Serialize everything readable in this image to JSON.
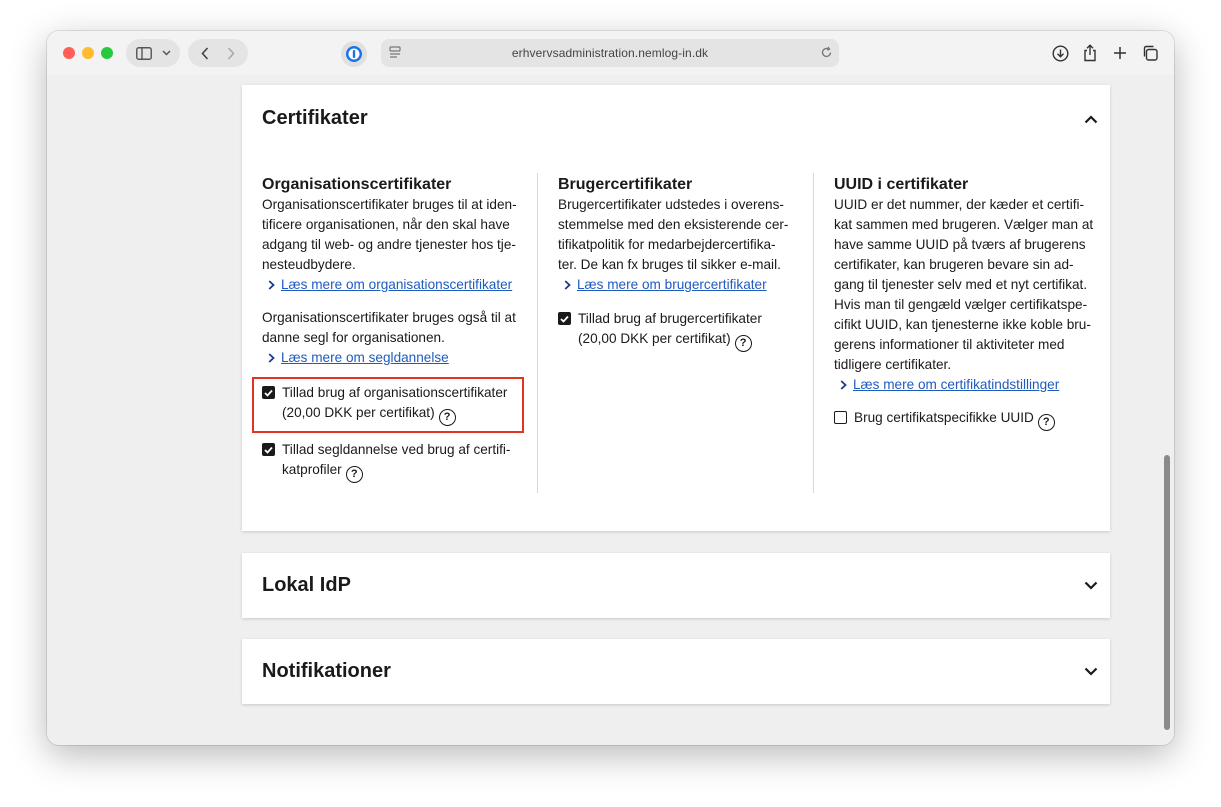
{
  "browser": {
    "url": "erhvervsadministration.nemlog-in.dk"
  },
  "sections": {
    "certifikater": {
      "title": "Certifikater",
      "columns": {
        "org": {
          "heading": "Organisationscertifikater",
          "text1": "Organisationscertifikater bruges til at iden-\ntificere organisationen, når den skal have\nadgang til web- og andre tjenester hos tje-\nnesteudbydere.",
          "link1": "Læs mere om organisationscertifikater",
          "text2": "Organisationscertifikater bruges også til at\ndanne segl for organisationen.",
          "link2": "Læs mere om segldannelse",
          "checkbox1": "Tillad brug af organisationscertifikater\n(20,00 DKK per certifikat)",
          "checkbox1_checked": true,
          "checkbox2": "Tillad segldannelse ved brug af certifi-\nkatprofiler",
          "checkbox2_checked": true
        },
        "bruger": {
          "heading": "Brugercertifikater",
          "text1": "Brugercertifikater udstedes i overens-\nstemmelse med den eksisterende cer-\ntifikatpolitik for medarbejdercertifika-\nter. De kan fx bruges til sikker e-mail.",
          "link1": "Læs mere om brugercertifikater",
          "checkbox1": "Tillad brug af brugercertifikater\n(20,00 DKK per certifikat)",
          "checkbox1_checked": true
        },
        "uuid": {
          "heading": "UUID i certifikater",
          "text1": "UUID er det nummer, der kæder et certifi-\nkat sammen med brugeren. Vælger man at\nhave samme UUID på tværs af brugerens\ncertifikater, kan brugeren bevare sin ad-\ngang til tjenester selv med et nyt certifikat.\nHvis man til gengæld vælger certifikatspe-\ncifikt UUID, kan tjenesterne ikke koble bru-\ngerens informationer til aktiviteter med\ntidligere certifikater.",
          "link1": "Læs mere om certifikatindstillinger",
          "checkbox1": "Brug certifikatspecifikke UUID",
          "checkbox1_checked": false
        }
      }
    },
    "lokal_idp": {
      "title": "Lokal IdP"
    },
    "notifikationer": {
      "title": "Notifikationer"
    }
  },
  "colors": {
    "link": "#1f5bbf",
    "highlight": "#e2341f",
    "text": "#1a1a1a"
  }
}
